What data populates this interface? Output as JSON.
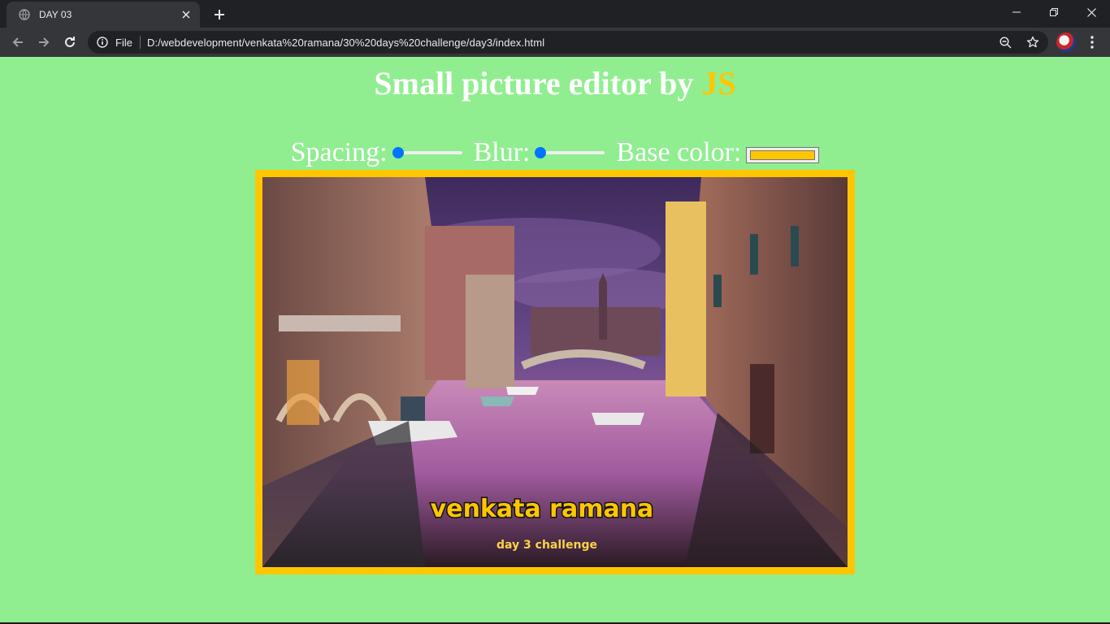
{
  "browser": {
    "tab_title": "DAY 03",
    "omnibox_scheme": "File",
    "url": "D:/webdevelopment/venkata%20ramana/30%20days%20challenge/day3/index.html",
    "icons": [
      "globe-icon",
      "close-icon",
      "plus-icon",
      "minimize-icon",
      "restore-icon",
      "close-window-icon",
      "back-arrow-icon",
      "forward-arrow-icon",
      "reload-icon",
      "info-icon",
      "zoom-icon",
      "star-icon",
      "menu-dots-icon"
    ]
  },
  "page": {
    "title_prefix": "Small picture editor by ",
    "title_highlight": "JS",
    "highlight_color": "#ffc600",
    "background_color": "#90ee90",
    "controls": {
      "spacing_label": "Spacing:",
      "spacing_value": 0,
      "blur_label": "Blur:",
      "blur_value": 0,
      "base_color_label": "Base color:",
      "base_color_value": "#ffc600"
    },
    "picture": {
      "caption_main": "venkata ramana",
      "caption_sub": "day 3 challenge"
    }
  }
}
